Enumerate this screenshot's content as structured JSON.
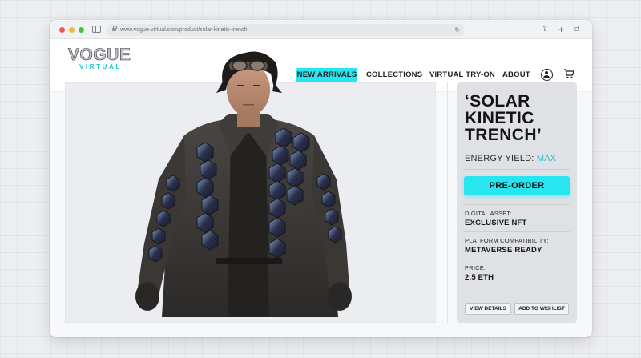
{
  "browser": {
    "url": "www.vogue-virtual.com/product/solar-kinetic-trench"
  },
  "brand": {
    "name": "VOGUE",
    "sub": "VIRTUAL",
    "accent_color": "#27e6f0"
  },
  "nav": {
    "items": [
      "NEW ARRIVALS",
      "COLLECTIONS",
      "VIRTUAL TRY-ON",
      "ABOUT"
    ],
    "active": "NEW ARRIVALS"
  },
  "product": {
    "title_line1": "‘SOLAR",
    "title_line2": "KINETIC",
    "title_line3": "TRENCH’",
    "energy_label": "ENERGY YIELD:",
    "energy_value": "MAX",
    "cta_label": "PRE-ORDER",
    "specs": [
      {
        "label": "DIGITAL ASSET:",
        "value": "EXCLUSIVE NFT"
      },
      {
        "label": "PLATFORM COMPATIBILITY:",
        "value": "METAVERSE READY"
      },
      {
        "label": "PRICE:",
        "value": "2.5 ETH"
      }
    ],
    "secondary_buttons": [
      "VIEW DETAILS",
      "ADD TO WISHLIST"
    ]
  },
  "icons": [
    "sidebar-icon",
    "lock-icon",
    "reload-icon",
    "share-icon",
    "new-tab-icon",
    "tabs-icon",
    "user-icon",
    "cart-icon"
  ]
}
